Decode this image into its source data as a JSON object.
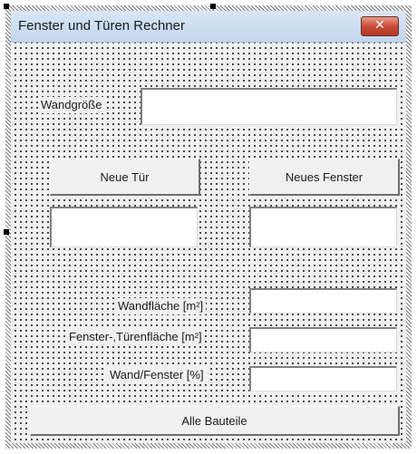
{
  "window": {
    "title": "Fenster und Türen Rechner",
    "close_glyph": "✕"
  },
  "fields": {
    "wall_size_label": "Wandgröße",
    "wall_area_label": "Wandfläche [m²]",
    "window_door_area_label": "Fenster-,Türenfläche [m²]",
    "wall_window_ratio_label": "Wand/Fenster [%]"
  },
  "buttons": {
    "new_door": "Neue Tür",
    "new_window": "Neues Fenster",
    "all_components": "Alle Bauteile"
  }
}
